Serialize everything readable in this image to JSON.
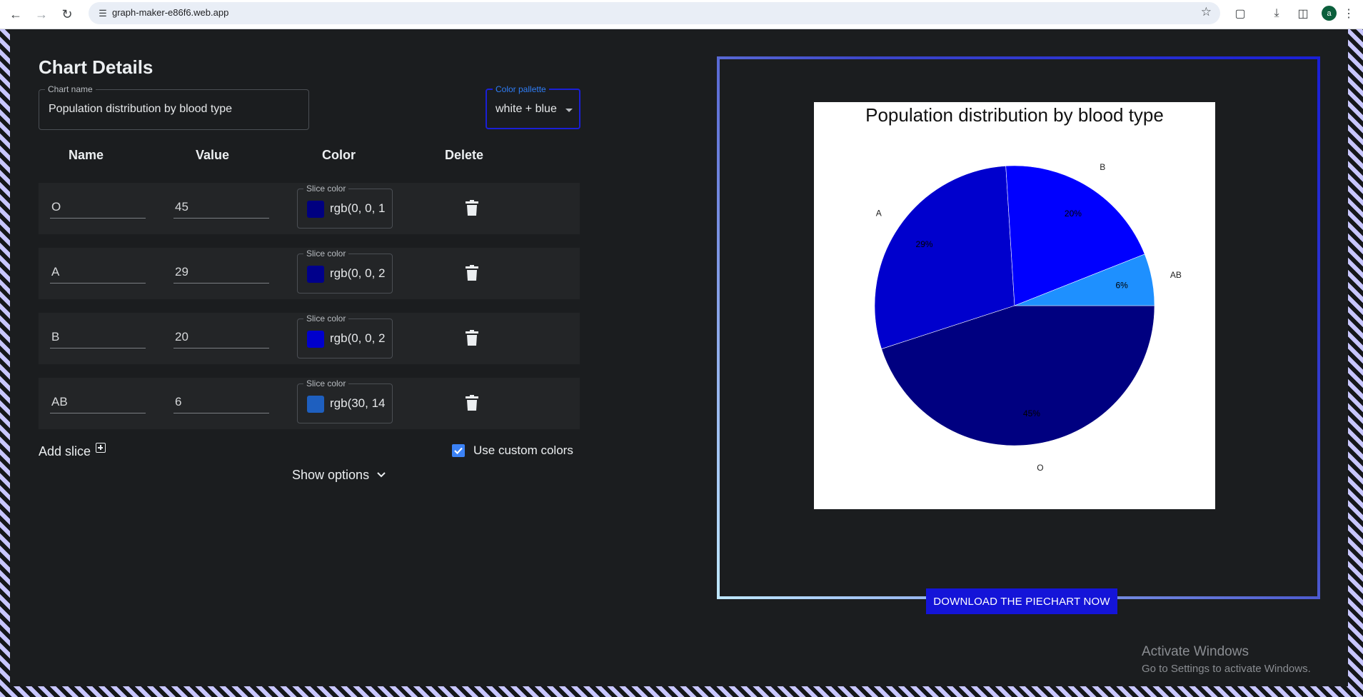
{
  "browser": {
    "url": "graph-maker-e86f6.web.app",
    "avatar_letter": "a"
  },
  "form": {
    "heading": "Chart Details",
    "chart_name_label": "Chart name",
    "chart_name_value": "Population distribution by blood type",
    "palette_label": "Color pallette",
    "palette_value": "white + blue",
    "columns": {
      "name": "Name",
      "value": "Value",
      "color": "Color",
      "delete": "Delete"
    },
    "swatch_label": "Slice color",
    "rows": [
      {
        "name": "O",
        "value": "45",
        "color_text": "rgb(0, 0, 1",
        "color": "#000080"
      },
      {
        "name": "A",
        "value": "29",
        "color_text": "rgb(0, 0, 2",
        "color": "#0000cd"
      },
      {
        "name": "B",
        "value": "20",
        "color_text": "rgb(0, 0, 2",
        "color": "#0000ff"
      },
      {
        "name": "AB",
        "value": "6",
        "color_text": "rgb(30, 14",
        "color": "#1e90ff"
      }
    ],
    "add_slice": "Add slice",
    "custom_colors_label": "Use custom colors",
    "custom_colors_checked": true,
    "show_options": "Show options"
  },
  "chart_data": {
    "type": "pie",
    "title": "Population distribution by blood type",
    "categories": [
      "O",
      "A",
      "B",
      "AB"
    ],
    "values": [
      45,
      29,
      20,
      6
    ],
    "percent_labels": [
      "45%",
      "29%",
      "20%",
      "6%"
    ],
    "colors": [
      "#000080",
      "#0000cd",
      "#0000ff",
      "#1e90ff"
    ]
  },
  "download_button": "DOWNLOAD THE PIECHART NOW",
  "watermark": {
    "line1": "Activate Windows",
    "line2": "Go to Settings to activate Windows."
  }
}
